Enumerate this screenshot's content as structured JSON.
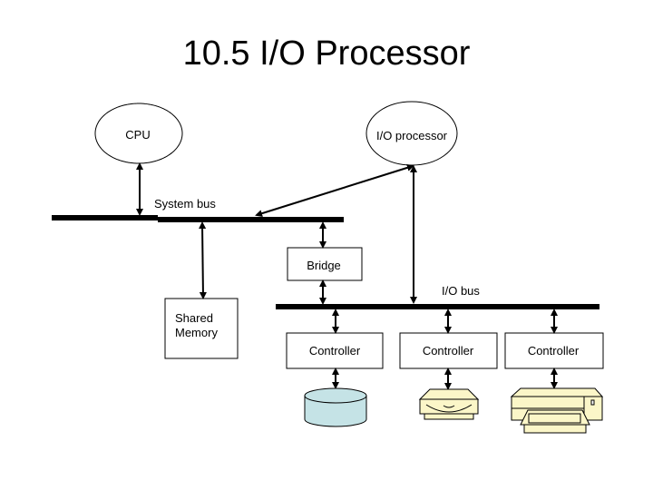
{
  "title": "10.5 I/O Processor",
  "nodes": {
    "cpu": "CPU",
    "io_processor": "I/O processor",
    "system_bus": "System bus",
    "bridge": "Bridge",
    "io_bus": "I/O bus",
    "shared_memory_line1": "Shared",
    "shared_memory_line2": "Memory",
    "controllers": [
      "Controller",
      "Controller",
      "Controller"
    ]
  },
  "devices": [
    {
      "name": "disk",
      "icon": "disk-cylinder-icon",
      "color": "#c5e3e6"
    },
    {
      "name": "cd-drive",
      "icon": "cd-drive-icon",
      "color": "#fbf6c8"
    },
    {
      "name": "printer",
      "icon": "printer-icon",
      "color": "#fbf6c8"
    }
  ],
  "connections": [
    [
      "CPU",
      "System bus"
    ],
    [
      "I/O processor",
      "System bus"
    ],
    [
      "I/O processor",
      "I/O bus"
    ],
    [
      "System bus",
      "Shared Memory"
    ],
    [
      "System bus",
      "Bridge"
    ],
    [
      "Bridge",
      "I/O bus"
    ],
    [
      "I/O bus",
      "Controller 1"
    ],
    [
      "I/O bus",
      "Controller 2"
    ],
    [
      "I/O bus",
      "Controller 3"
    ],
    [
      "Controller 1",
      "Disk"
    ],
    [
      "Controller 2",
      "CD drive"
    ],
    [
      "Controller 3",
      "Printer"
    ]
  ]
}
